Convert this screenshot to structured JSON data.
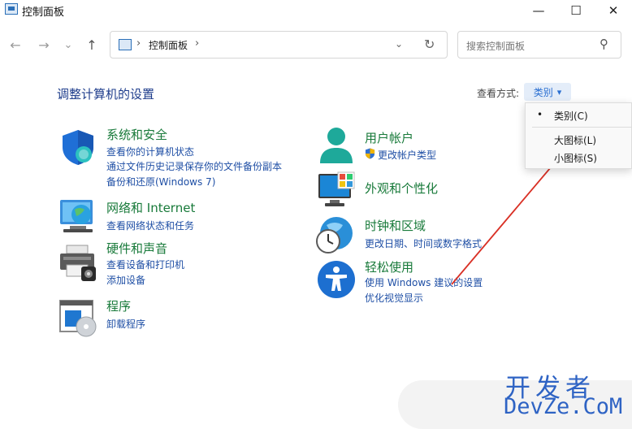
{
  "window": {
    "title": "控制面板",
    "minimize_glyph": "—",
    "maximize_glyph": "☐",
    "close_glyph": "✕"
  },
  "nav": {
    "back_glyph": "←",
    "forward_glyph": "→",
    "recent_glyph": "⌄",
    "up_glyph": "↑",
    "breadcrumb_sep": "›",
    "breadcrumb": "控制面板",
    "dropdown_glyph": "⌄",
    "refresh_glyph": "↻",
    "search_placeholder": "搜索控制面板",
    "search_glyph": "⚲"
  },
  "header": {
    "title": "调整计算机的设置",
    "view_by_label": "查看方式:",
    "view_by_value": "类别",
    "view_by_caret": "▾"
  },
  "view_menu": {
    "items": [
      {
        "label": "类别(C)",
        "selected": true
      },
      {
        "label": "大图标(L)",
        "selected": false
      },
      {
        "label": "小图标(S)",
        "selected": false
      }
    ],
    "bullet": "•"
  },
  "categories": {
    "system_security": {
      "title": "系统和安全",
      "links": [
        "查看你的计算机状态",
        "通过文件历史记录保存你的文件备份副本",
        "备份和还原(Windows 7)"
      ],
      "icon": "shield-icon"
    },
    "network": {
      "title": "网络和 Internet",
      "links": [
        "查看网络状态和任务"
      ],
      "icon": "network-globe-icon"
    },
    "hardware": {
      "title": "硬件和声音",
      "links": [
        "查看设备和打印机",
        "添加设备"
      ],
      "icon": "printer-icon"
    },
    "programs": {
      "title": "程序",
      "links": [
        "卸载程序"
      ],
      "icon": "programs-disc-icon"
    },
    "user_accounts": {
      "title": "用户帐户",
      "links": [
        "更改帐户类型"
      ],
      "icon": "user-icon"
    },
    "appearance": {
      "title": "外观和个性化",
      "links": [],
      "icon": "monitor-icon"
    },
    "clock_region": {
      "title": "时钟和区域",
      "links": [
        "更改日期、时间或数字格式"
      ],
      "icon": "clock-globe-icon"
    },
    "ease_of_access": {
      "title": "轻松使用",
      "links": [
        "使用 Windows 建议的设置",
        "优化视觉显示"
      ],
      "icon": "accessibility-icon"
    }
  },
  "watermark": {
    "cn": "开发者",
    "en": "DevZe.CoM"
  },
  "colors": {
    "category_title": "#187a3a",
    "link": "#1f4fa5",
    "heading": "#1e3d8c",
    "annotation_arrow": "#d93025"
  }
}
